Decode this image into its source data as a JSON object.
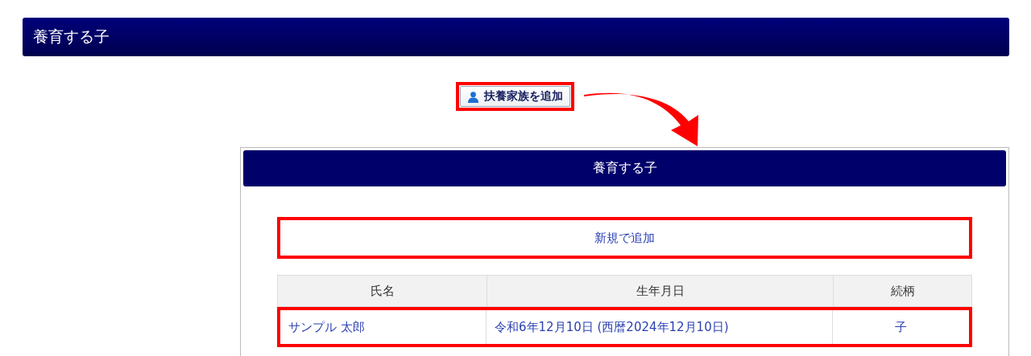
{
  "header": {
    "title": "養育する子"
  },
  "add_family_button": {
    "label": "扶養家族を追加",
    "highlighted": true
  },
  "panel": {
    "title": "養育する子",
    "new_button": {
      "label": "新規で追加",
      "highlighted": true
    },
    "table": {
      "columns": [
        "氏名",
        "生年月日",
        "続柄"
      ],
      "rows": [
        {
          "cells": [
            "サンプル 太郎",
            "令和6年12月10日 (西暦2024年12月10日)",
            "子"
          ],
          "highlighted": true
        }
      ]
    }
  }
}
